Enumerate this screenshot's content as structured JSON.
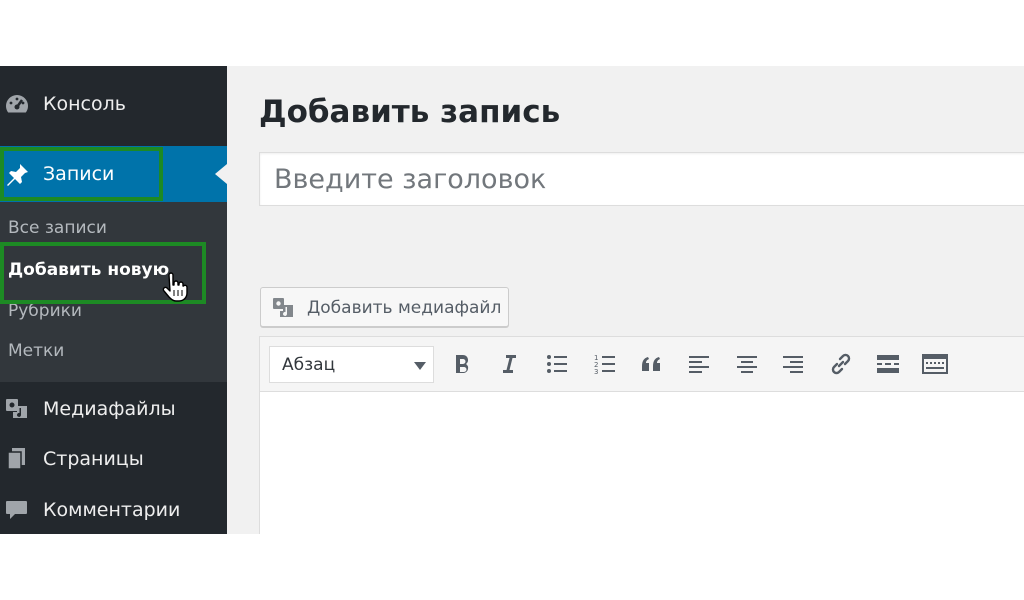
{
  "sidebar": {
    "items": [
      {
        "label": "Консоль",
        "icon": "dashboard-icon"
      },
      {
        "label": "Записи",
        "icon": "pushpin-icon"
      },
      {
        "label": "Медиафайлы",
        "icon": "media-icon"
      },
      {
        "label": "Страницы",
        "icon": "pages-icon"
      },
      {
        "label": "Комментарии",
        "icon": "comment-icon"
      }
    ],
    "submenu": [
      {
        "label": "Все записи"
      },
      {
        "label": "Добавить новую"
      },
      {
        "label": "Рубрики"
      },
      {
        "label": "Метки"
      }
    ],
    "active_item": "Записи",
    "active_subitem": "Добавить новую"
  },
  "main": {
    "page_title": "Добавить запись",
    "title_input": {
      "placeholder": "Введите заголовок",
      "value": ""
    },
    "media_button_label": "Добавить медиафайл",
    "editor": {
      "format_select": "Абзац",
      "toolbar_icons": [
        "bold-icon",
        "italic-icon",
        "bullet-list-icon",
        "numbered-list-icon",
        "blockquote-icon",
        "align-left-icon",
        "align-center-icon",
        "align-right-icon",
        "link-icon",
        "read-more-icon",
        "toolbar-toggle-icon"
      ]
    }
  },
  "colors": {
    "sidebar_bg": "#23282d",
    "submenu_bg": "#32373c",
    "active_bg": "#0073aa",
    "highlight_border": "#1d8a24",
    "content_bg": "#f1f1f1"
  }
}
